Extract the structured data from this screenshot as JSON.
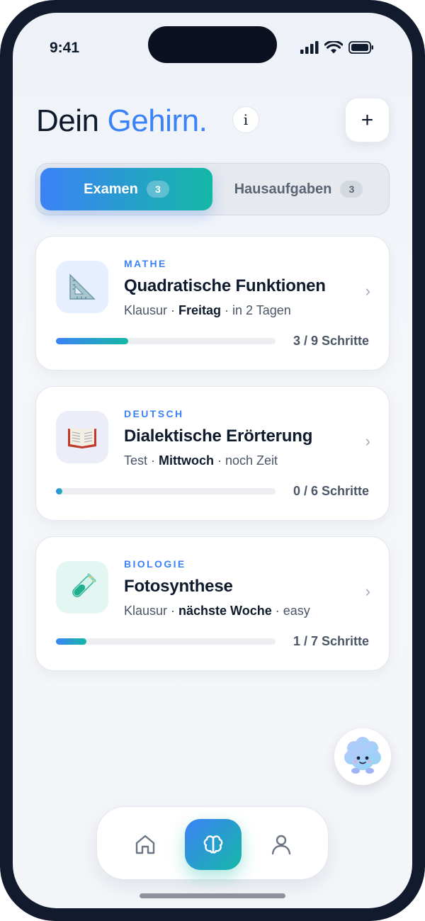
{
  "status_bar": {
    "time": "9:41"
  },
  "header": {
    "title_prefix": "Dein",
    "title_highlight": "Gehirn.",
    "info_label": "i",
    "add_label": "+"
  },
  "tabs": [
    {
      "label": "Examen",
      "count": "3",
      "active": true
    },
    {
      "label": "Hausaufgaben",
      "count": "3",
      "active": false
    }
  ],
  "cards": [
    {
      "subject": "MATHE",
      "title": "Quadratische Funktionen",
      "meta_type": "Klausur",
      "meta_day": "Freitag",
      "meta_note": "in 2 Tagen",
      "progress": 0.33,
      "steps": "3 / 9 Schritte",
      "icon": "set-square-icon"
    },
    {
      "subject": "DEUTSCH",
      "title": "Dialektische Erörterung",
      "meta_type": "Test",
      "meta_day": "Mittwoch",
      "meta_note": "noch Zeit",
      "progress": 0.0,
      "steps": "0 / 6 Schritte",
      "icon": "open-book-icon"
    },
    {
      "subject": "BIOLOGIE",
      "title": "Fotosynthese",
      "meta_type": "Klausur",
      "meta_day": "nächste Woche",
      "meta_note": "easy",
      "progress": 0.14,
      "steps": "1 / 7 Schritte",
      "icon": "test-tube-icon"
    }
  ],
  "colors": {
    "accent_blue": "#3b82f6",
    "accent_teal": "#14b8a6",
    "text_dark": "#0f1b2d"
  },
  "nav": {
    "items": [
      "home-icon",
      "brain-icon",
      "profile-icon"
    ],
    "active": "brain-icon"
  }
}
